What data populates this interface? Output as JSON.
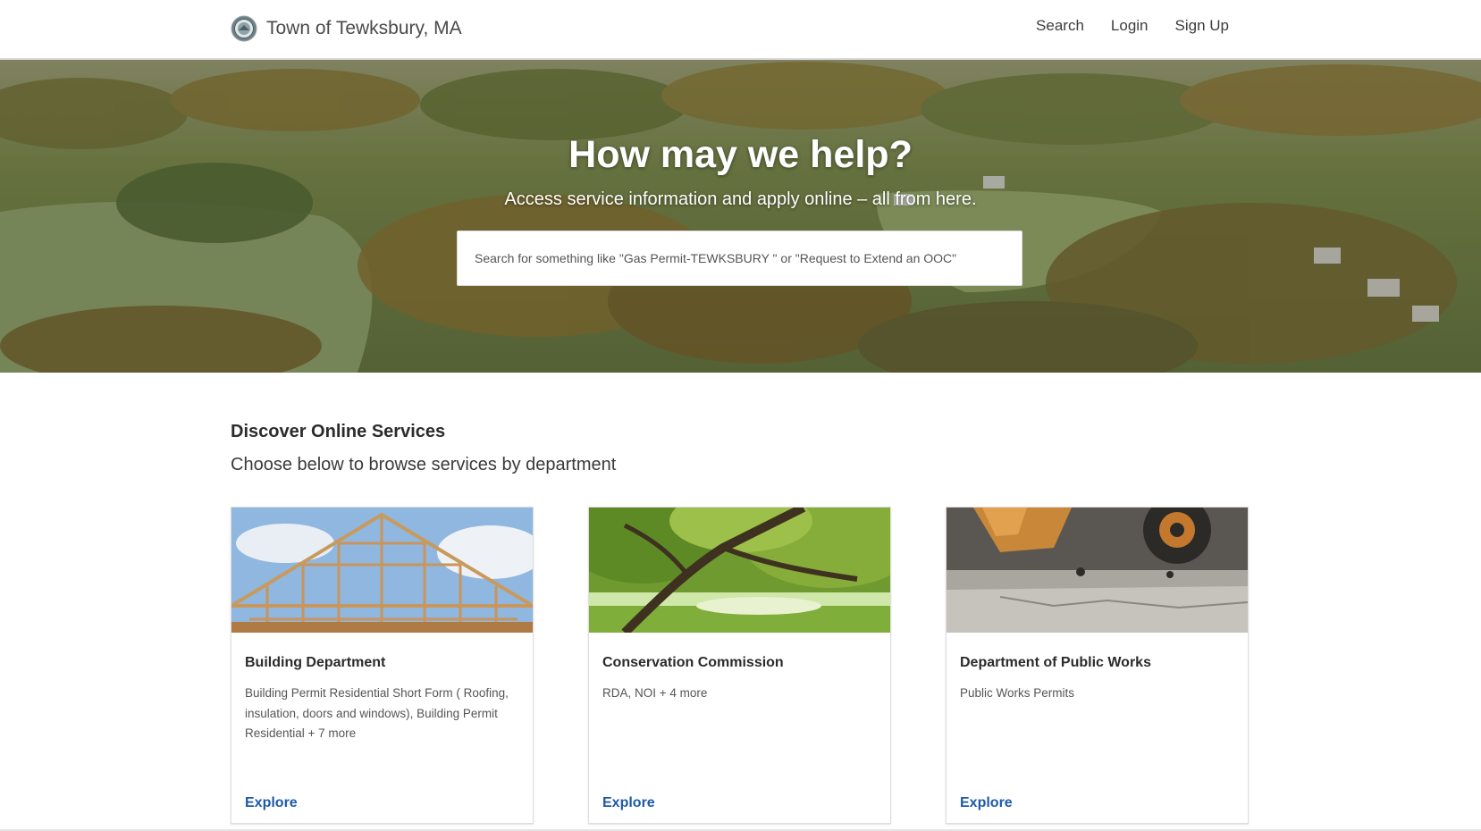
{
  "header": {
    "brand": "Town of Tewksbury, MA",
    "nav": {
      "search": "Search",
      "login": "Login",
      "signup": "Sign Up"
    }
  },
  "hero": {
    "title": "How may we help?",
    "subtitle": "Access service information and apply online – all from here.",
    "search_placeholder": "Search for something like \"Gas Permit-TEWKSBURY \" or \"Request to Extend an OOC\""
  },
  "discover": {
    "title": "Discover Online Services",
    "subtitle": "Choose below to browse services by department",
    "cards": [
      {
        "title": "Building Department",
        "description": "Building Permit Residential Short Form ( Roofing, insulation, doors and windows), Building Permit Residential + 7 more",
        "link": "Explore"
      },
      {
        "title": "Conservation Commission",
        "description": "RDA, NOI + 4 more",
        "link": "Explore"
      },
      {
        "title": "Department of Public Works",
        "description": "Public Works Permits",
        "link": "Explore"
      }
    ]
  },
  "colors": {
    "link": "#1e5aa8",
    "header_border": "#d9d9d9",
    "hero_overlay": "#6f7e48"
  },
  "icons": {
    "brand": "town-seal-icon"
  }
}
